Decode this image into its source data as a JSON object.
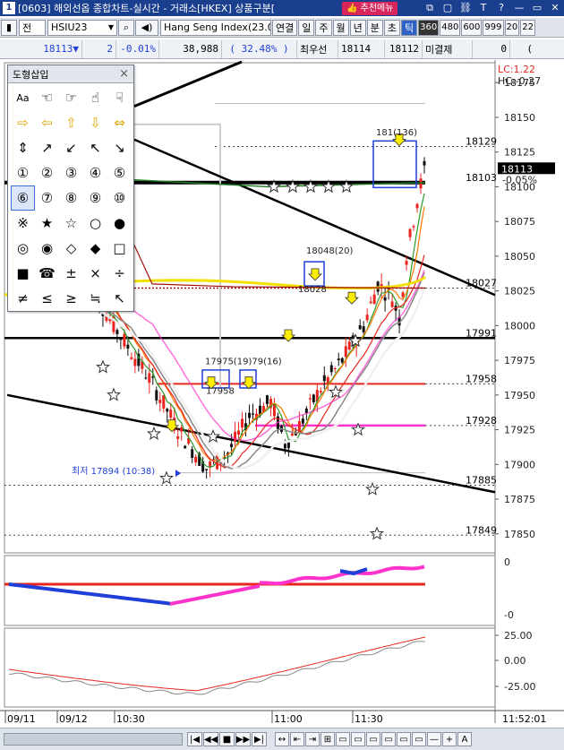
{
  "titlebar": {
    "number": "1",
    "text": "[0603] 해외선옵 종합차트-실시간 - 거래소[HKEX] 상품구분[",
    "recommend_label": "추천메뉴",
    "icons": [
      "copy-icon",
      "window-icon",
      "link-icon",
      "text-icon",
      "help-icon",
      "minimize-icon",
      "maximize-icon",
      "close-icon"
    ],
    "icon_glyphs": [
      "⧉",
      "▢",
      "⛓",
      "T",
      "?",
      "—",
      "▭",
      "✕"
    ]
  },
  "toolbar1": {
    "market_label": "전",
    "symbol": "HSIU23",
    "product_name": "Hang Seng Index(23.0",
    "period_buttons": [
      "연결",
      "일",
      "주",
      "월",
      "년",
      "분",
      "초",
      "틱"
    ],
    "active_period": "틱",
    "interval_buttons": [
      "360",
      "480",
      "600",
      "999",
      "20",
      "22"
    ],
    "selected_interval": "360"
  },
  "toolbar2": {
    "price": "18113▼",
    "change": "2",
    "change_pct": "-0.01%",
    "volume": "38,988",
    "volume_ratio": "( 32.48% )",
    "best_ask_label": "최우선",
    "best_ask": "18114",
    "best_bid": "18112",
    "unsettled_label": "미결제",
    "unsettled_value": "0",
    "paren_value": "("
  },
  "shape_panel": {
    "title": "도형삽입",
    "close": "×",
    "glyphs": [
      "Aa",
      "☜",
      "☞",
      "☝",
      "☟",
      "⇨",
      "⇦",
      "⇧",
      "⇩",
      "⇔",
      "⇕",
      "↗",
      "↙",
      "↖",
      "↘",
      "①",
      "②",
      "③",
      "④",
      "⑤",
      "⑥",
      "⑦",
      "⑧",
      "⑨",
      "⑩",
      "※",
      "★",
      "☆",
      "○",
      "●",
      "◎",
      "◉",
      "◇",
      "◆",
      "□",
      "■",
      "☎",
      "±",
      "×",
      "÷",
      "≠",
      "≤",
      "≥",
      "≒",
      "↖"
    ],
    "selected_index": 20
  },
  "price_axis": {
    "lc_label": "LC:1.22",
    "hc_label": "HC:-0.27",
    "ticks": [
      "18175",
      "18150",
      "18125",
      "18100",
      "18075",
      "18050",
      "18025",
      "18000",
      "17975",
      "17950",
      "17925",
      "17900",
      "17875",
      "17850"
    ],
    "current_price": "18113",
    "current_pct": "-0.05%"
  },
  "chart_data": {
    "type": "line",
    "price_labels": [
      {
        "text": "18129",
        "price": 18129
      },
      {
        "text": "18103",
        "price": 18103
      },
      {
        "text": "18027",
        "price": 18027
      },
      {
        "text": "17991",
        "price": 17991
      },
      {
        "text": "17958",
        "price": 17958
      },
      {
        "text": "17928",
        "price": 17928
      },
      {
        "text": "17885",
        "price": 17885
      },
      {
        "text": "17849",
        "price": 17849
      }
    ],
    "annotations": [
      {
        "text": "181(136)"
      },
      {
        "text": "18048(20)"
      },
      {
        "text": "18028"
      },
      {
        "text": "17975(19)79(16)"
      },
      {
        "text": "17958"
      },
      {
        "text": "최저 17894 (10:38)"
      }
    ],
    "ylim": [
      17835,
      18190
    ],
    "x_labels": [
      "09/11",
      "09/12",
      "10:30",
      "11:00",
      "11:30"
    ],
    "time_label": "11:52:01"
  },
  "indicator1_axis": [
    "0",
    "-0"
  ],
  "indicator2_axis": [
    "25.00",
    "0.00",
    "-25.00"
  ],
  "colors": {
    "title_bg": "#1b3f8f",
    "up": "#e8261f",
    "down": "#1f3fd8",
    "accent_magenta": "#ff33cc",
    "accent_yellow": "#f2e100",
    "recommend": "#d8265b"
  },
  "bottombar": {
    "nav_buttons": [
      "|◀",
      "◀◀",
      "■",
      "▶▶",
      "▶|"
    ],
    "right_buttons": [
      "↔",
      "⇤",
      "⇥",
      "⊞",
      "▭",
      "▭",
      "▭",
      "▭",
      "▭",
      "▭",
      "—",
      "+",
      "A"
    ]
  }
}
